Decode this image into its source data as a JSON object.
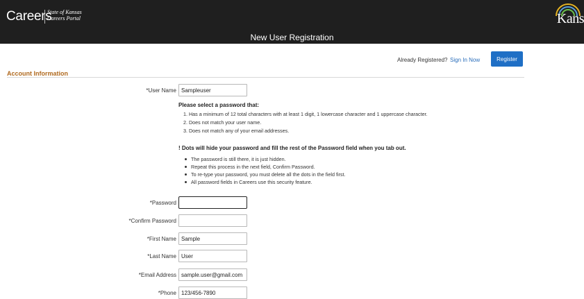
{
  "header": {
    "app_name": "Careers",
    "portal_line1": "State of Kansas",
    "portal_line2": "Careers Portal",
    "brand": "Kans",
    "page_title": "New User Registration"
  },
  "registration": {
    "already_text": "Already Registered?",
    "sign_in_link": "Sign In Now",
    "register_button": "Register"
  },
  "section": {
    "title": "Account Information"
  },
  "password_rules": {
    "heading": "Please select a password that:",
    "items": [
      "1. Has a minimum of 12 total characters with at least 1 digit, 1 lowercase character and 1 uppercase character.",
      "2. Does not match your user name.",
      "3. Does not match any of your email addresses."
    ]
  },
  "dots_notice": {
    "heading": "! Dots will hide your password and fill the rest of the Password field when you tab out.",
    "items": [
      "The password is still there, it is just hidden.",
      "Repeat this process in the next field, Confirm Password.",
      "To re-type your password, you must delete all the dots in the field first.",
      "All password fields in Careers use this security feature."
    ]
  },
  "form": {
    "username": {
      "label": "*User Name",
      "value": "Sampleuser"
    },
    "password": {
      "label": "*Password",
      "value": ""
    },
    "confirm_password": {
      "label": "*Confirm Password",
      "value": ""
    },
    "first_name": {
      "label": "*First Name",
      "value": "Sample"
    },
    "last_name": {
      "label": "*Last Name",
      "value": "User"
    },
    "email": {
      "label": "*Email Address",
      "value": "sample.user@gmail.com"
    },
    "phone": {
      "label": "*Phone",
      "value": "123/456-7890"
    }
  },
  "colors": {
    "header_bg": "#1f1f1f",
    "accent": "#1f6fc5",
    "link": "#2a6ebb",
    "section_title": "#b06a1f"
  }
}
